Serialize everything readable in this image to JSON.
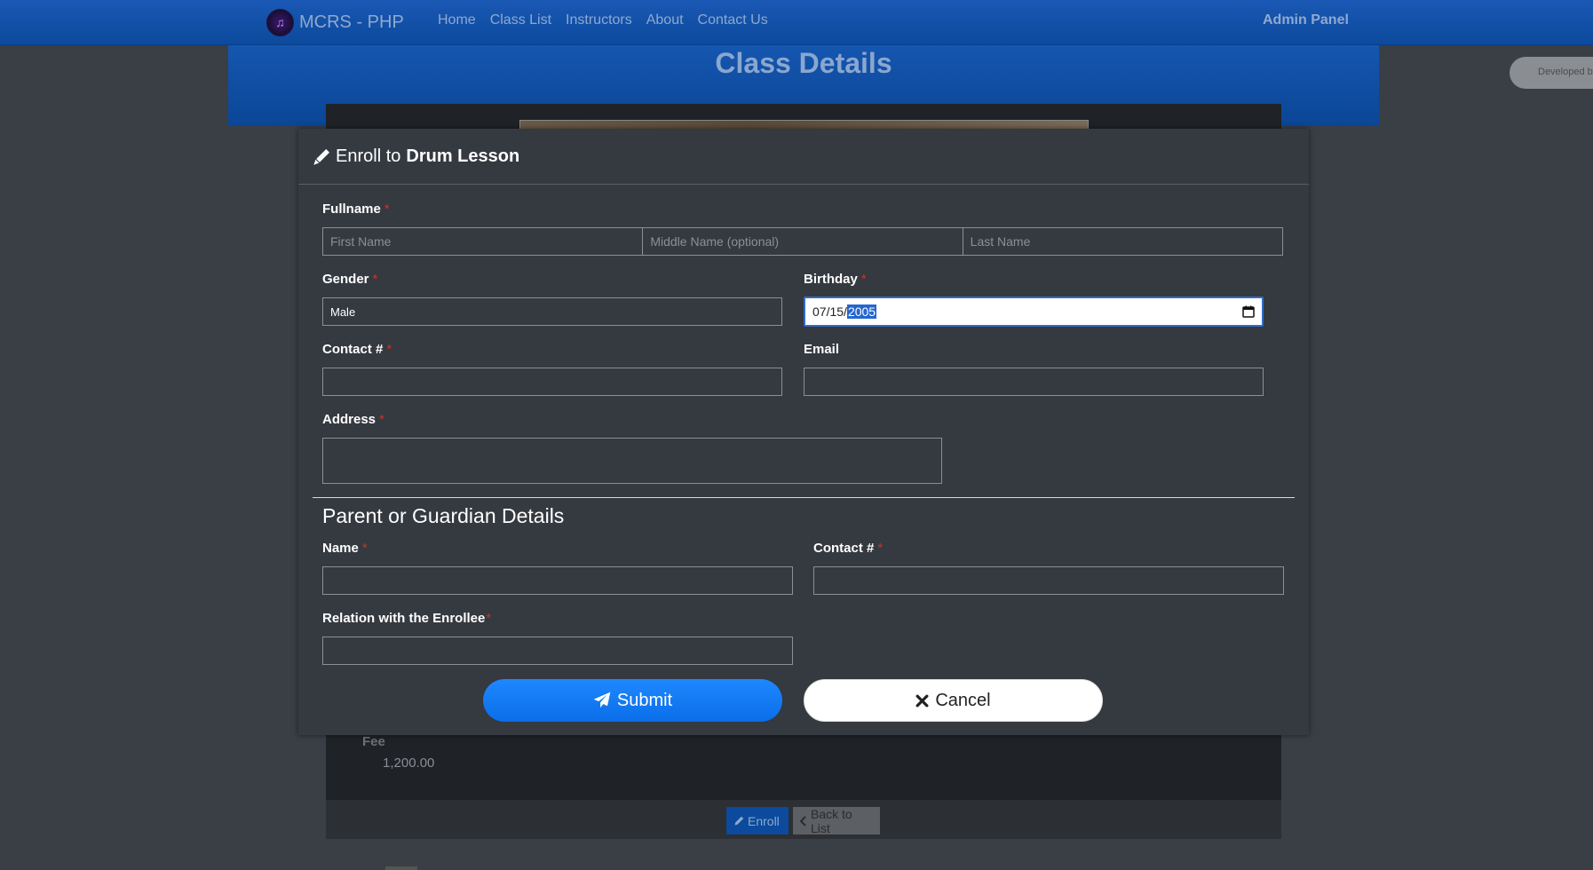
{
  "navbar": {
    "brand": "MCRS - PHP",
    "links": [
      "Home",
      "Class List",
      "Instructors",
      "About",
      "Contact Us"
    ],
    "admin": "Admin Panel"
  },
  "hero": {
    "title": "Class Details"
  },
  "dev_badge": "Developed b",
  "background": {
    "fee_label": "Fee",
    "fee_value": "1,200.00",
    "enroll_label": "Enroll",
    "back_label": "Back to List"
  },
  "modal": {
    "title_prefix": "Enroll to",
    "title_class": "Drum Lesson",
    "fullname_label": "Fullname",
    "first_name_placeholder": "First Name",
    "middle_name_placeholder": "Middle Name (optional)",
    "last_name_placeholder": "Last Name",
    "gender_label": "Gender",
    "gender_value": "Male",
    "birthday_label": "Birthday",
    "birthday_mmdd": "07/15/",
    "birthday_year": "2005",
    "contact_label": "Contact #",
    "email_label": "Email",
    "address_label": "Address",
    "required_mark": "*",
    "section_title": "Parent or Guardian Details",
    "guardian_name_label": "Name",
    "guardian_contact_label": "Contact #",
    "relation_label": "Relation with the Enrollee",
    "submit_label": "Submit",
    "cancel_label": "Cancel"
  },
  "colors": {
    "primary": "#0d6efd",
    "navbar": "#0b4a9c",
    "modal_bg": "#353940",
    "required": "#c0392b"
  }
}
